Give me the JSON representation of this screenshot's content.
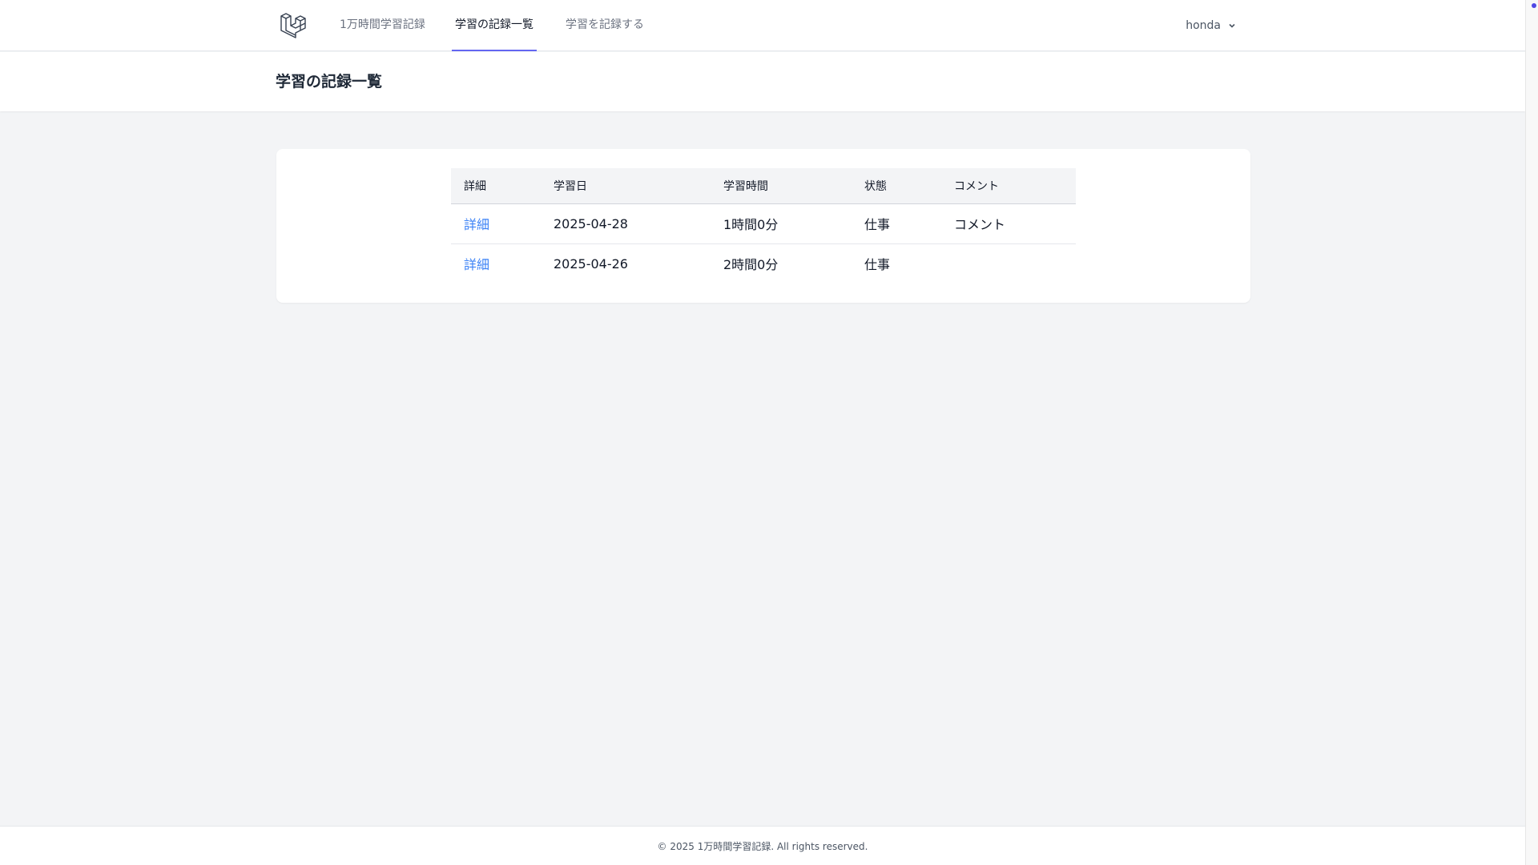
{
  "nav": {
    "items": [
      {
        "label": "1万時間学習記録"
      },
      {
        "label": "学習の記録一覧"
      },
      {
        "label": "学習を記録する"
      }
    ],
    "user": "honda",
    "accent_color": "#6366f1"
  },
  "header": {
    "title": "学習の記録一覧"
  },
  "table": {
    "headers": [
      "詳細",
      "学習日",
      "学習時間",
      "状態",
      "コメント"
    ],
    "rows": [
      {
        "detail": "詳細",
        "date": "2025-04-28",
        "duration": "1時間0分",
        "status": "仕事",
        "comment": "コメント"
      },
      {
        "detail": "詳細",
        "date": "2025-04-26",
        "duration": "2時間0分",
        "status": "仕事",
        "comment": ""
      }
    ],
    "link_color": "#3b82f6"
  },
  "footer": {
    "text": "© 2025 1万時間学習記録. All rights reserved."
  },
  "icons": {
    "logo": "laravel-logo-icon",
    "chevron": "chevron-down-icon"
  }
}
